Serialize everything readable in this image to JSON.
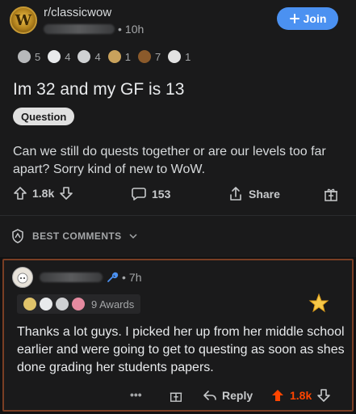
{
  "post": {
    "subreddit": "r/classicwow",
    "avatar_letter": "W",
    "age": "10h",
    "join_label": "Join",
    "awards": [
      "5",
      "4",
      "4",
      "1",
      "7",
      "1"
    ],
    "title": "Im 32 and my GF is 13",
    "flair": "Question",
    "body": "Can we still do quests together or are our levels too far apart? Sorry kind of new to WoW.",
    "upvotes": "1.8k",
    "comments": "153",
    "share_label": "Share"
  },
  "sort": {
    "label": "BEST COMMENTS"
  },
  "comment": {
    "age": "7h",
    "awards_label": "9 Awards",
    "body": "Thanks a lot guys. I picked her up from her middle school earlier and were going to get to questing as soon as shes done grading her students papers.",
    "more": "•••",
    "reply_label": "Reply",
    "score": "1.8k"
  },
  "colors": {
    "accent": "#4b91f1",
    "upvote": "#ff4500",
    "highlight_border": "#7a3e24"
  },
  "icons": [
    "wow-logo-icon",
    "plus-icon",
    "award-icon",
    "upvote-icon",
    "downvote-icon",
    "comment-icon",
    "share-icon",
    "gift-icon",
    "shield-icon",
    "chevron-down-icon",
    "wrench-icon",
    "star-icon",
    "reply-icon",
    "more-icon"
  ]
}
